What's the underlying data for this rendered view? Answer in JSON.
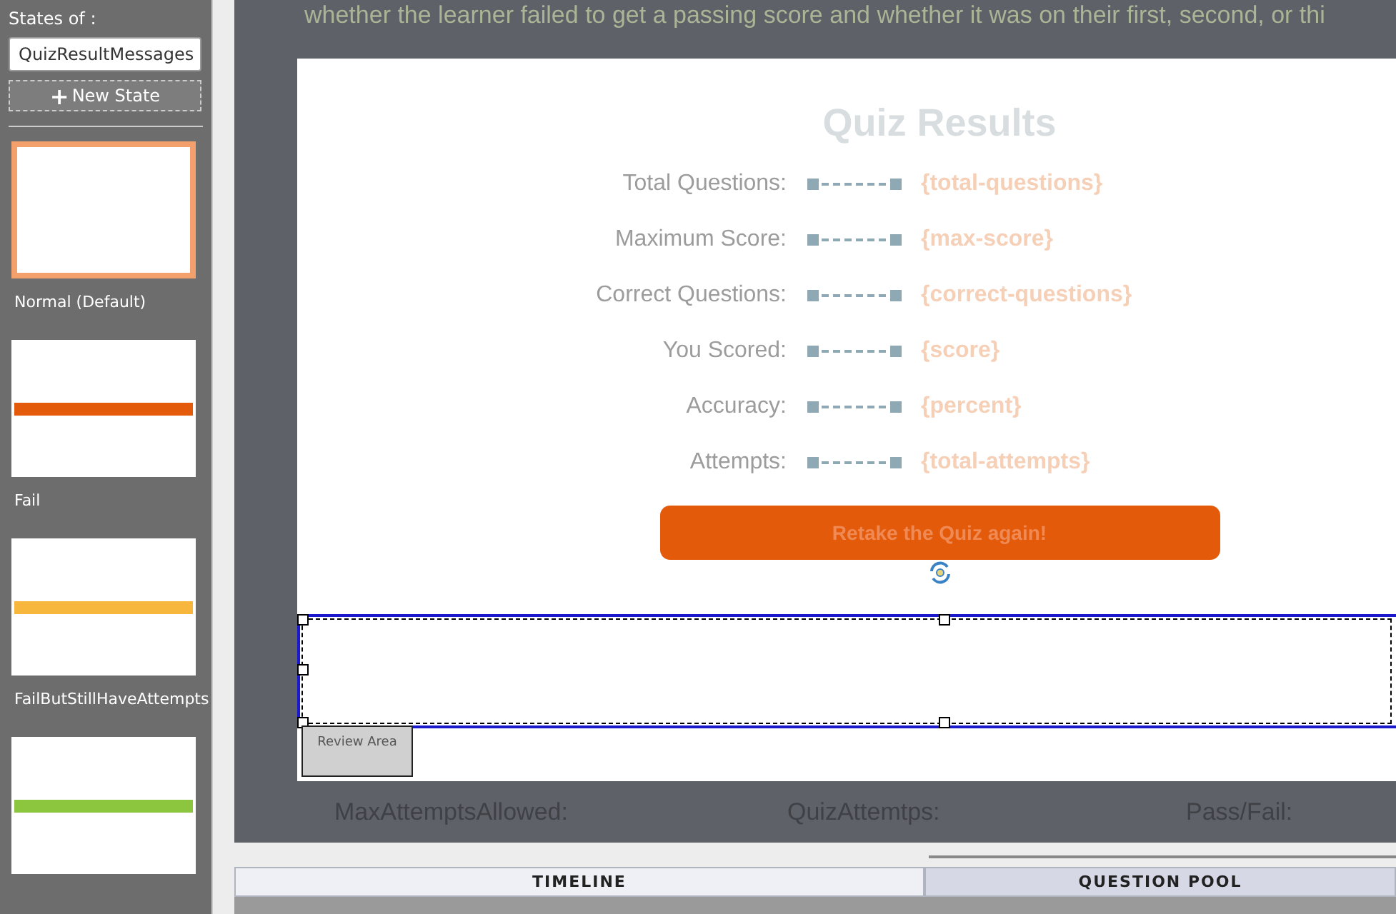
{
  "states_panel": {
    "label": "States of :",
    "dropdown": {
      "value": "QuizResultMessages"
    },
    "new_state_button": {
      "icon": "+",
      "label": "New State"
    },
    "states": [
      {
        "name": "Normal (Default)",
        "selected": true
      },
      {
        "name": "Fail",
        "selected": false,
        "color": "#e35a0b"
      },
      {
        "name": "FailButStillHaveAttempts",
        "selected": false,
        "color": "#f7b63c"
      },
      {
        "selected": false,
        "color": "#8cc63f"
      }
    ]
  },
  "canvas": {
    "caption": "whether the learner failed to get a passing score and whether it was on their first, second, or thi",
    "slide": {
      "title": "Quiz Results",
      "rows": [
        {
          "label": "Total Questions:",
          "value": "{total-questions}"
        },
        {
          "label": "Maximum Score:",
          "value": "{max-score}"
        },
        {
          "label": "Correct Questions:",
          "value": "{correct-questions}"
        },
        {
          "label": "You Scored:",
          "value": "{score}"
        },
        {
          "label": "Accuracy:",
          "value": "{percent}"
        },
        {
          "label": "Attempts:",
          "value": "{total-attempts}"
        }
      ],
      "retake_button": "Retake the Quiz again!",
      "review_area": "Review Area"
    },
    "variables": [
      "MaxAttemptsAllowed:",
      "QuizAttemtps:",
      "Pass/Fail:"
    ]
  },
  "bottom_tabs": [
    {
      "label": "TIMELINE",
      "selected": false
    },
    {
      "label": "QUESTION POOL",
      "selected": true
    }
  ]
}
